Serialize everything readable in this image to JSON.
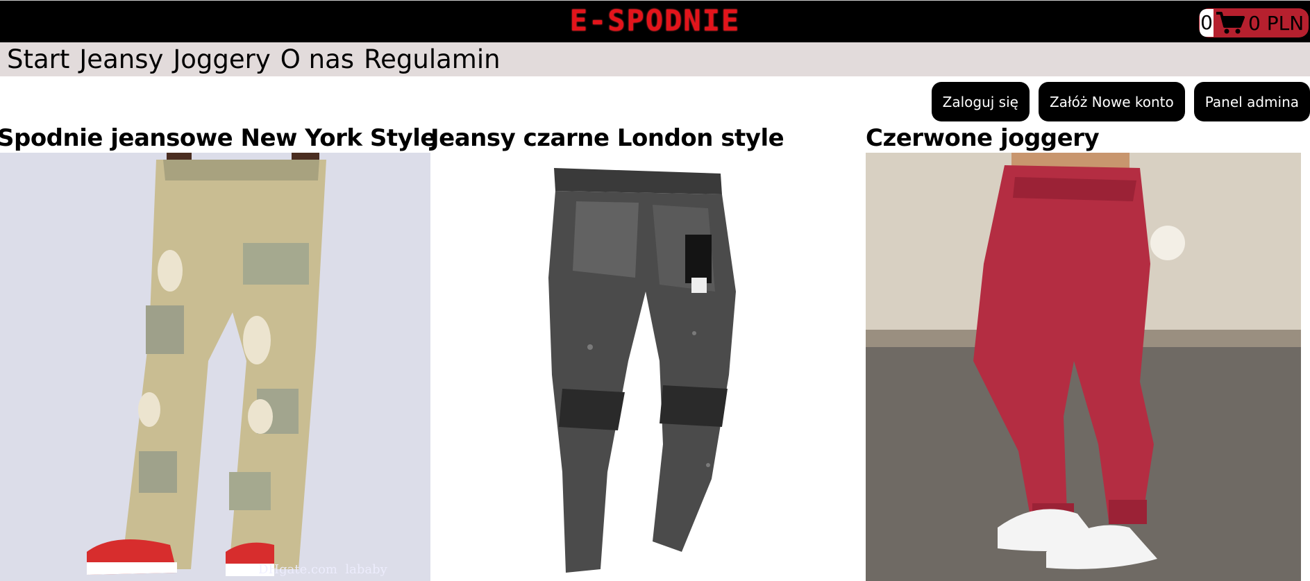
{
  "header": {
    "brand": "E-SPODNIE",
    "cart": {
      "count": "0",
      "total": "0 PLN",
      "icon": "cart-icon"
    }
  },
  "nav": {
    "items": [
      "Start",
      "Jeansy",
      "Joggery",
      "O nas",
      "Regulamin"
    ]
  },
  "auth": {
    "login": "Zaloguj się",
    "register": "Załóż Nowe konto",
    "admin": "Panel admina"
  },
  "products": [
    {
      "title": "Spodnie jeansowe New York Style",
      "image": "light-distressed-cargo-jeans-photo",
      "watermark": "DHgate.com  lababy"
    },
    {
      "title": "Jeansy czarne London style",
      "image": "black-acid-wash-skinny-jeans-photo"
    },
    {
      "title": "Czerwone joggery",
      "image": "red-joggers-photo"
    }
  ],
  "colors": {
    "brand_red": "#e3141b",
    "cart_bg": "#b6202e",
    "nav_bg": "#e2dbdb",
    "button_bg": "#000000"
  }
}
